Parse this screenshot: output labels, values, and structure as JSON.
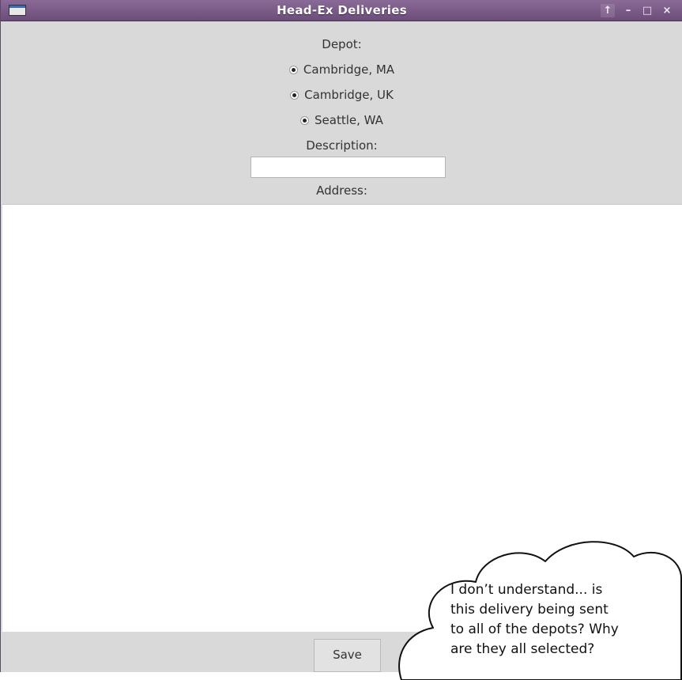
{
  "window": {
    "title": "Head-Ex Deliveries",
    "buttons": {
      "up": "↑",
      "minimize": "–",
      "maximize": "□",
      "close": "×"
    }
  },
  "form": {
    "depot_label": "Depot:",
    "depots": [
      {
        "label": "Cambridge, MA",
        "selected": true
      },
      {
        "label": "Cambridge, UK",
        "selected": true
      },
      {
        "label": "Seattle, WA",
        "selected": true
      }
    ],
    "description_label": "Description:",
    "description_value": "",
    "address_label": "Address:",
    "address_value": "",
    "save_label": "Save"
  },
  "annotation": {
    "line1": "I don’t understand... is",
    "line2": "this delivery being sent",
    "line3": "to all of the depots? Why",
    "line4": "are they all selected?"
  }
}
